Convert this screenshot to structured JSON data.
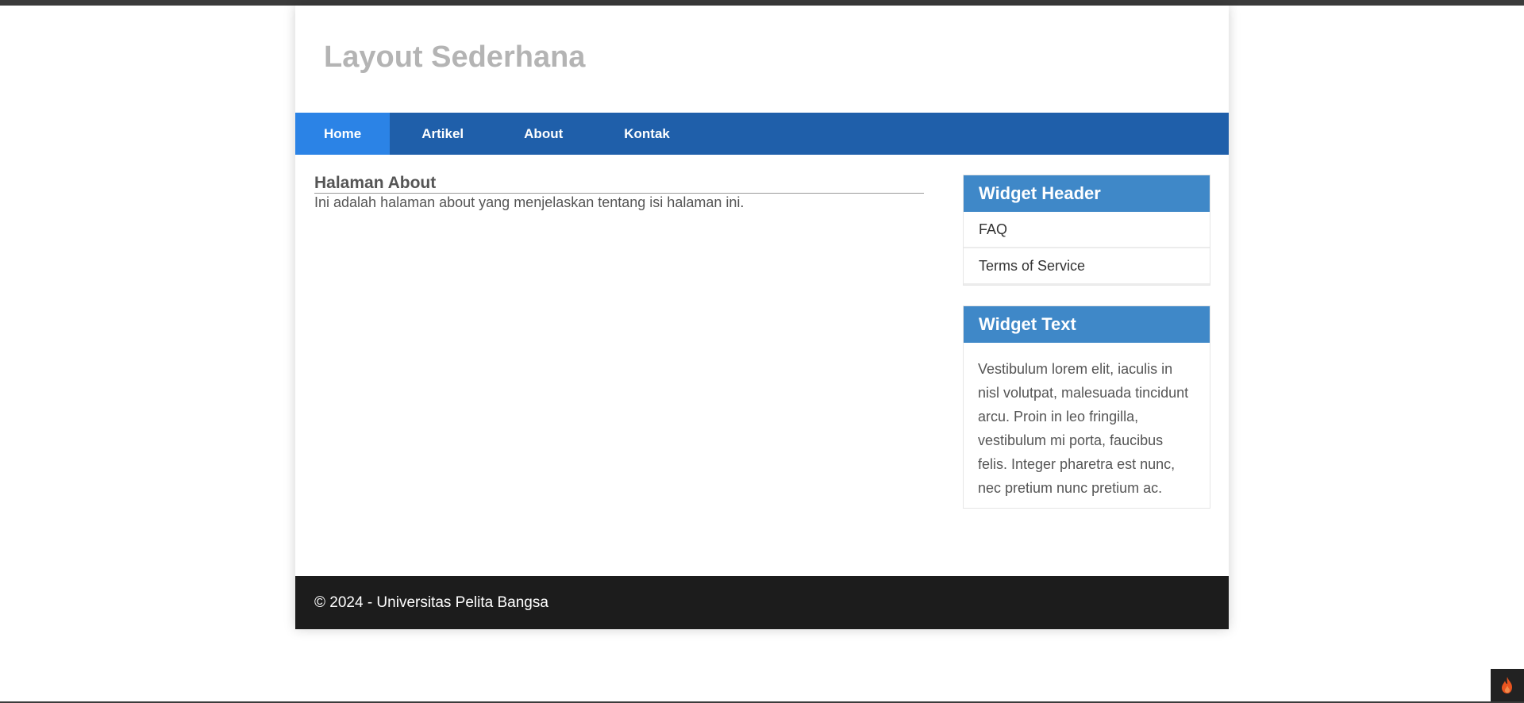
{
  "site": {
    "title": "Layout Sederhana"
  },
  "nav": {
    "items": [
      {
        "label": "Home",
        "active": true
      },
      {
        "label": "Artikel",
        "active": false
      },
      {
        "label": "About",
        "active": false
      },
      {
        "label": "Kontak",
        "active": false
      }
    ]
  },
  "main": {
    "heading": "Halaman About",
    "text": "Ini adalah halaman about yang menjelaskan tentang isi halaman ini."
  },
  "sidebar": {
    "widget_header": {
      "title": "Widget Header",
      "links": [
        "FAQ",
        "Terms of Service"
      ]
    },
    "widget_text": {
      "title": "Widget Text",
      "body": "Vestibulum lorem elit, iaculis in nisl volutpat, malesuada tincidunt arcu. Proin in leo fringilla, vestibulum mi porta, faucibus felis. Integer pharetra est nunc, nec pretium nunc pretium ac."
    }
  },
  "footer": {
    "text": "© 2024 - Universitas Pelita Bangsa"
  },
  "colors": {
    "nav_bg": "#1f5faa",
    "nav_active": "#2b83e6",
    "widget_head": "#3f88c8",
    "footer_bg": "#1c1c1c",
    "title": "#b4b4b4"
  },
  "icons": {
    "corner_button": "fire-icon"
  }
}
